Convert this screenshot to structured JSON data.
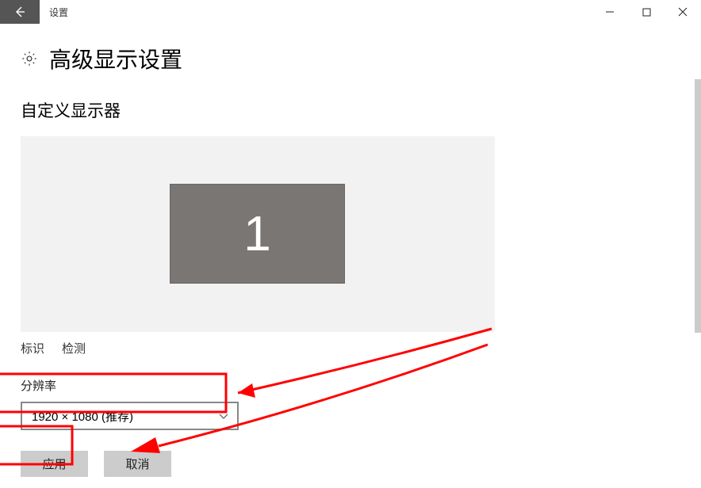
{
  "app_title": "设置",
  "page_title": "高级显示设置",
  "section_title": "自定义显示器",
  "monitor_label": "1",
  "links": {
    "identify": "标识",
    "detect": "检测"
  },
  "resolution": {
    "label": "分辨率",
    "selected": "1920 × 1080 (推荐)"
  },
  "buttons": {
    "apply": "应用",
    "cancel": "取消"
  }
}
